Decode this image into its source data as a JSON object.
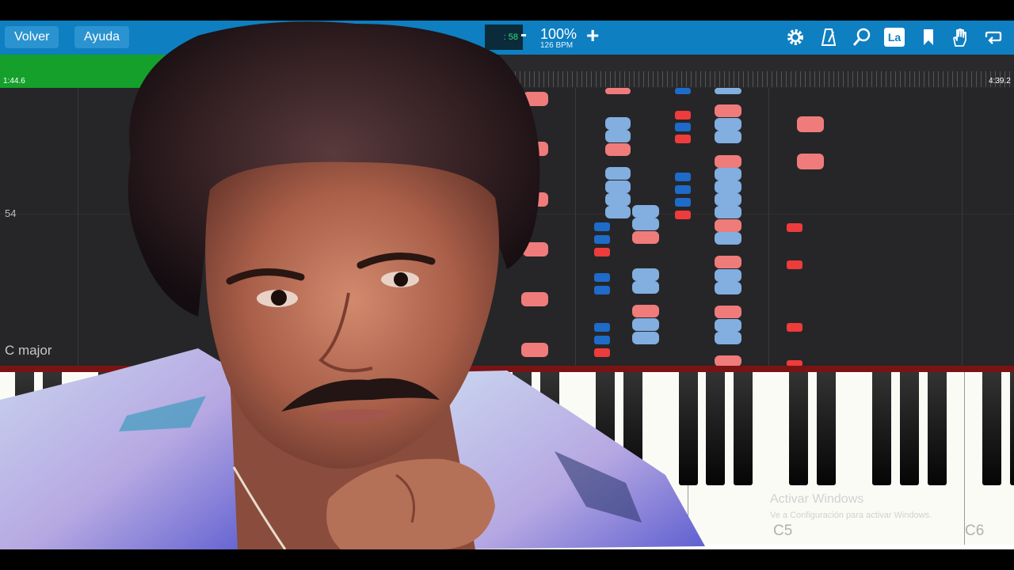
{
  "toolbar": {
    "back_label": "Volver",
    "help_label": "Ayuda",
    "speed_box_value": ": 58",
    "minus_label": "-",
    "speed_percent": "100%",
    "bpm": "126 BPM",
    "plus_label": "+",
    "key_badge": "La",
    "icons": [
      "gear-icon",
      "metronome-icon",
      "search-icon",
      "key-label-icon",
      "bookmark-icon",
      "hand-icon",
      "loop-icon"
    ]
  },
  "timeline": {
    "elapsed": "1:44.6",
    "total": "4:39.2",
    "progress_fraction": 0.37
  },
  "roll": {
    "measure_number": "54",
    "key_signature": "C major"
  },
  "keyboard": {
    "label_c5": "C5",
    "label_c6": "C6"
  },
  "watermark": {
    "title": "Activar Windows",
    "subtitle": "Ve a Configuración para activar Windows."
  },
  "colors": {
    "toolbar": "#0e7fc1",
    "progress": "#14a02a",
    "note_right_hand": "#f07b7b",
    "note_left_hand": "#82aee0"
  }
}
